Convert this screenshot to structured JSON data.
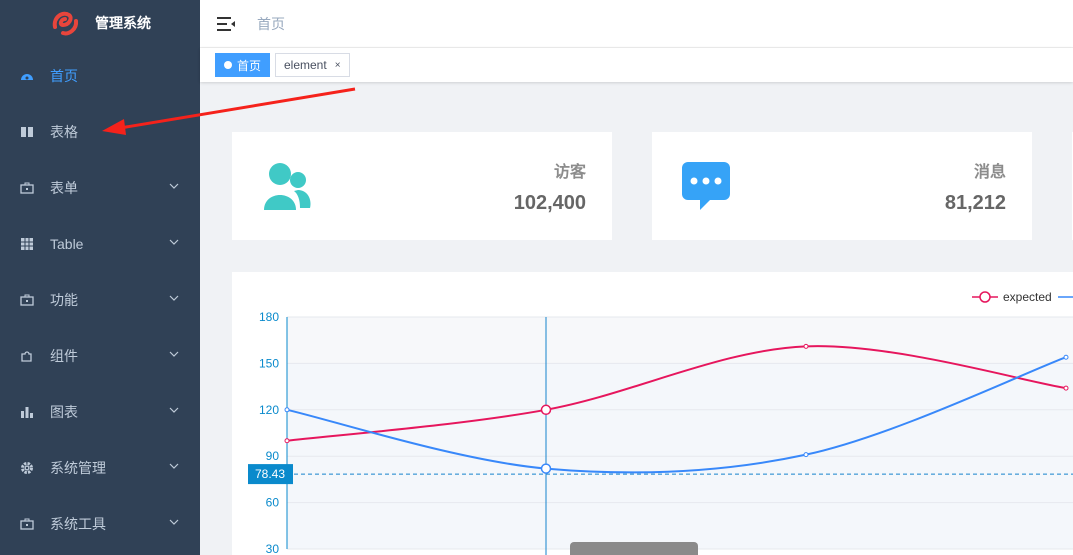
{
  "app": {
    "title": "管理系统"
  },
  "sidebar": {
    "items": [
      {
        "label": "首页",
        "icon": "dashboard-icon",
        "active": true,
        "has_children": false
      },
      {
        "label": "表格",
        "icon": "book-icon",
        "active": false,
        "has_children": false
      },
      {
        "label": "表单",
        "icon": "briefcase-icon",
        "active": false,
        "has_children": true
      },
      {
        "label": "Table",
        "icon": "table-grid-icon",
        "active": false,
        "has_children": true
      },
      {
        "label": "功能",
        "icon": "briefcase-icon",
        "active": false,
        "has_children": true
      },
      {
        "label": "组件",
        "icon": "puzzle-icon",
        "active": false,
        "has_children": true
      },
      {
        "label": "图表",
        "icon": "bar-chart-icon",
        "active": false,
        "has_children": true
      },
      {
        "label": "系统管理",
        "icon": "gear-icon",
        "active": false,
        "has_children": true
      },
      {
        "label": "系统工具",
        "icon": "briefcase-icon",
        "active": false,
        "has_children": true
      }
    ]
  },
  "navbar": {
    "breadcrumb": "首页"
  },
  "tags": [
    {
      "label": "首页",
      "active": true
    },
    {
      "label": "element",
      "active": false,
      "close": "×"
    }
  ],
  "cards": [
    {
      "label": "访客",
      "value": "102,400",
      "icon": "users-icon",
      "color": "#40c9c6"
    },
    {
      "label": "消息",
      "value": "81,212",
      "icon": "message-icon",
      "color": "#36a3f7"
    }
  ],
  "colors": {
    "sidebar_bg": "#304156",
    "accent": "#409eff",
    "expected": "#e6165d",
    "actual": "#3888fa"
  },
  "chart_data": {
    "type": "line",
    "y_ticks": [
      "180",
      "150",
      "120",
      "90",
      "60",
      "30"
    ],
    "ylim": [
      30,
      180
    ],
    "series": [
      {
        "name": "expected",
        "color": "#e6165d",
        "values": [
          100,
          120,
          161,
          134
        ]
      },
      {
        "name": "",
        "color": "#3888fa",
        "values": [
          120,
          82,
          91,
          154
        ]
      }
    ],
    "crosshair_label": "78.43",
    "legend": "top-right"
  }
}
